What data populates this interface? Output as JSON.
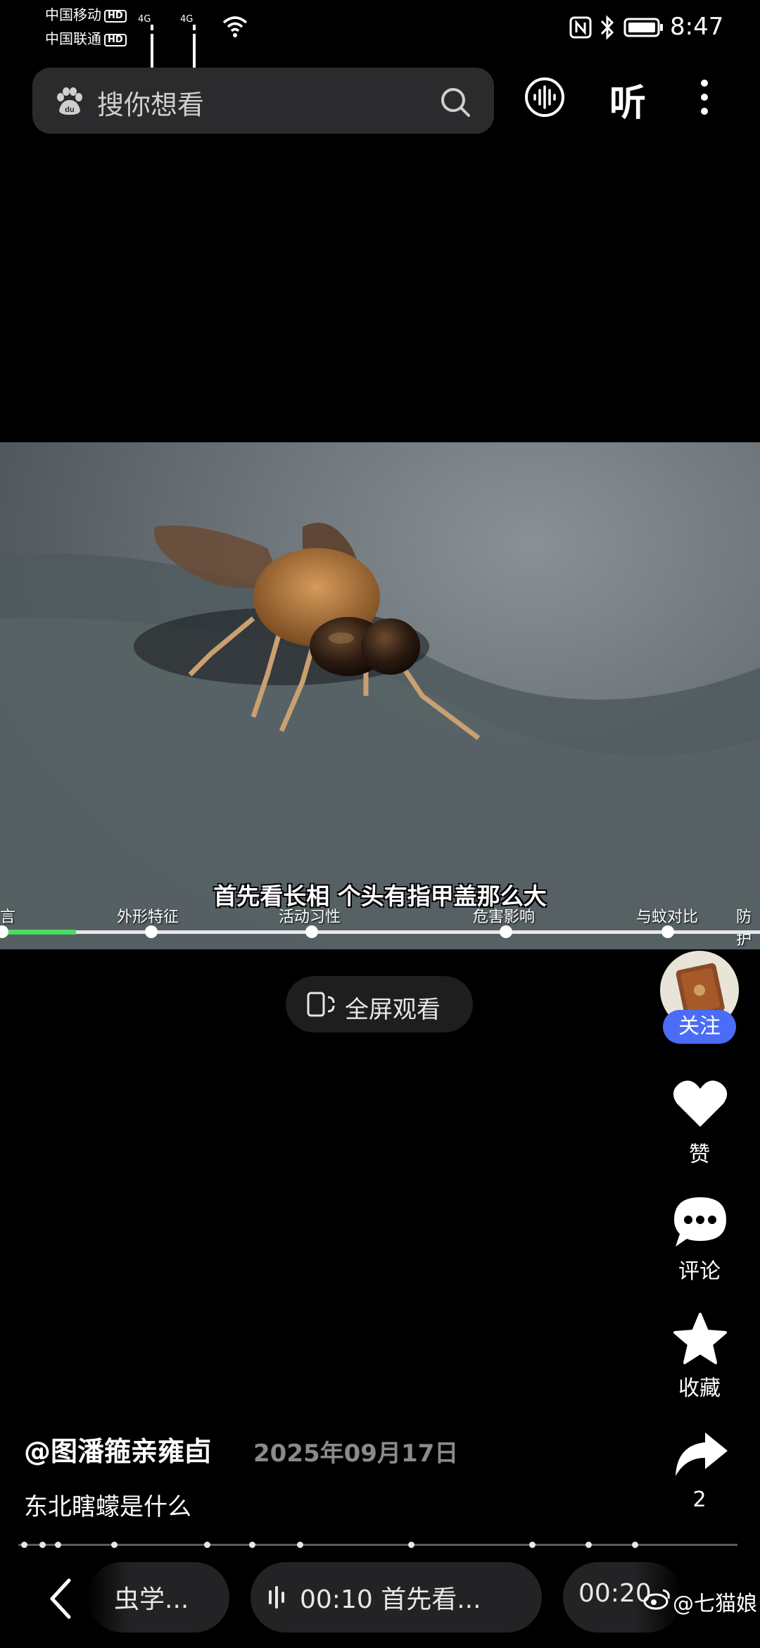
{
  "status_bar": {
    "carrier1": "中国移动",
    "carrier2": "中国联通",
    "hd": "HD",
    "net1": "4G",
    "net2": "4G",
    "time": "8:47"
  },
  "search": {
    "placeholder": "搜你想看",
    "listen_label": "听"
  },
  "video": {
    "subtitle": "首先看长相  个头有指甲盖那么大",
    "chapters": [
      "言",
      "外形特征",
      "活动习性",
      "危害影响",
      "与蚊对比",
      "防护"
    ],
    "progress_fraction": 0.1
  },
  "fullscreen": {
    "label": "全屏观看"
  },
  "sidebar": {
    "follow_label": "关注",
    "like_label": "赞",
    "comment_label": "评论",
    "favorite_label": "收藏",
    "share_count": "2"
  },
  "post": {
    "author": "@图潘箍亲雍卣",
    "date": "2025年09月17日",
    "title": "东北瞎蠓是什么"
  },
  "bottom_nav": {
    "prev_chip": "虫学...",
    "current_chip": "00:10 首先看...",
    "next_chip": "00:20 ",
    "watermark": "@七猫娘"
  },
  "colors": {
    "accent_blue": "#4a6cf7",
    "progress_green": "#4cd964",
    "background": "#000000"
  }
}
